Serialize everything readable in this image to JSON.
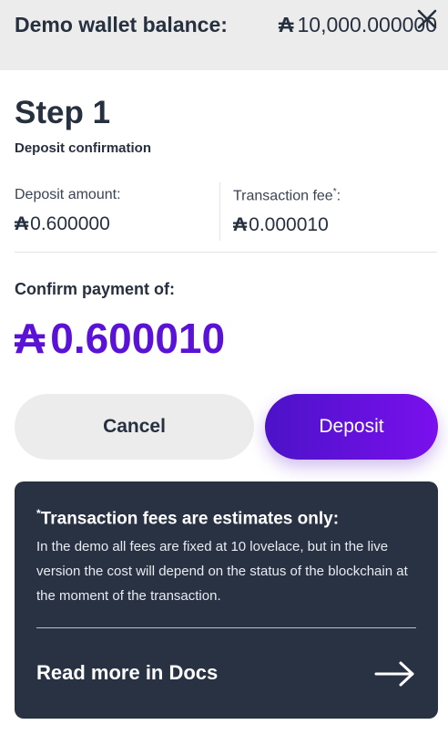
{
  "header": {
    "balance_label": "Demo wallet balance:",
    "ada_symbol": "₳",
    "balance_value": "10,000.000000",
    "close_icon": "close-icon"
  },
  "step": {
    "title": "Step 1",
    "subtitle": "Deposit confirmation"
  },
  "amounts": {
    "deposit_label": "Deposit amount:",
    "deposit_value": "0.600000",
    "fee_label": "Transaction fee",
    "fee_marker": "*",
    "fee_colon": ":",
    "fee_value": "0.000010"
  },
  "confirm": {
    "label": "Confirm payment of:",
    "value": "0.600010",
    "accent_color": "#5a13d6"
  },
  "buttons": {
    "cancel_label": "Cancel",
    "deposit_label": "Deposit"
  },
  "info": {
    "marker": "*",
    "title": "Transaction fees are estimates only:",
    "body": "In the demo all fees are fixed at 10 lovelace, but in the live version the cost will depend on the status of the blockchain at the moment of the transaction.",
    "link_label": "Read more in Docs",
    "link_icon": "arrow-right-icon",
    "background_color": "#283243"
  }
}
